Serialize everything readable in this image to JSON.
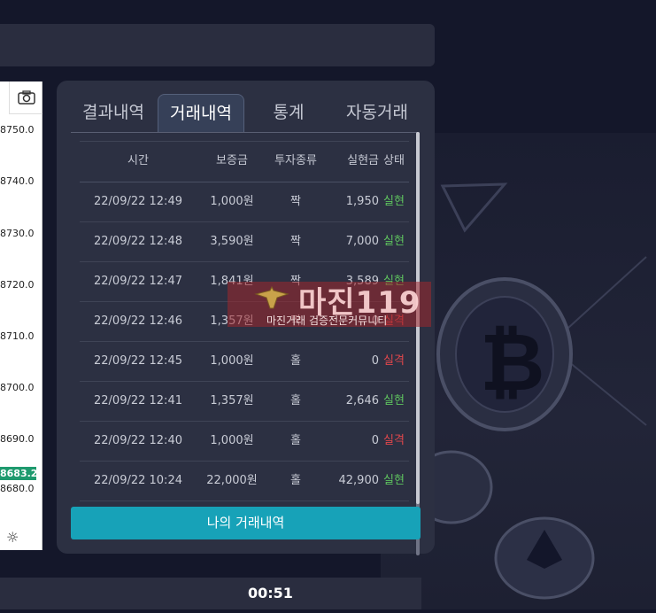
{
  "chart": {
    "y_ticks": [
      "8750.0",
      "8740.0",
      "8730.0",
      "8720.0",
      "8710.0",
      "8700.0",
      "8690.0",
      "8680.0"
    ],
    "current_price": "8683.2"
  },
  "trade_panel": {
    "tabs": [
      {
        "label": "결과내역",
        "active": false
      },
      {
        "label": "거래내역",
        "active": true
      },
      {
        "label": "통계",
        "active": false
      },
      {
        "label": "자동거래",
        "active": false
      }
    ],
    "columns": [
      "시간",
      "보증금",
      "투자종류",
      "실현금",
      "상태"
    ],
    "rows": [
      {
        "time": "22/09/22 12:49",
        "amount": "1,000원",
        "type": "짝",
        "payout": "1,950",
        "status": "실현"
      },
      {
        "time": "22/09/22 12:48",
        "amount": "3,590원",
        "type": "짝",
        "payout": "7,000",
        "status": "실현"
      },
      {
        "time": "22/09/22 12:47",
        "amount": "1,841원",
        "type": "짝",
        "payout": "3,589",
        "status": "실현"
      },
      {
        "time": "22/09/22 12:46",
        "amount": "1,357원",
        "type": "짝",
        "payout": "0",
        "status": "실격"
      },
      {
        "time": "22/09/22 12:45",
        "amount": "1,000원",
        "type": "홀",
        "payout": "0",
        "status": "실격"
      },
      {
        "time": "22/09/22 12:41",
        "amount": "1,357원",
        "type": "홀",
        "payout": "2,646",
        "status": "실현"
      },
      {
        "time": "22/09/22 12:40",
        "amount": "1,000원",
        "type": "홀",
        "payout": "0",
        "status": "실격"
      },
      {
        "time": "22/09/22 10:24",
        "amount": "22,000원",
        "type": "홀",
        "payout": "42,900",
        "status": "실현"
      }
    ],
    "my_trades_button": "나의 거래내역"
  },
  "watermark": {
    "title": "마진119",
    "subtitle": "마진거래 검증전문커뮤니티"
  },
  "timer": "00:51",
  "colors": {
    "win": "#5fc45f",
    "lose": "#e0474c",
    "button": "#17a2b8"
  }
}
